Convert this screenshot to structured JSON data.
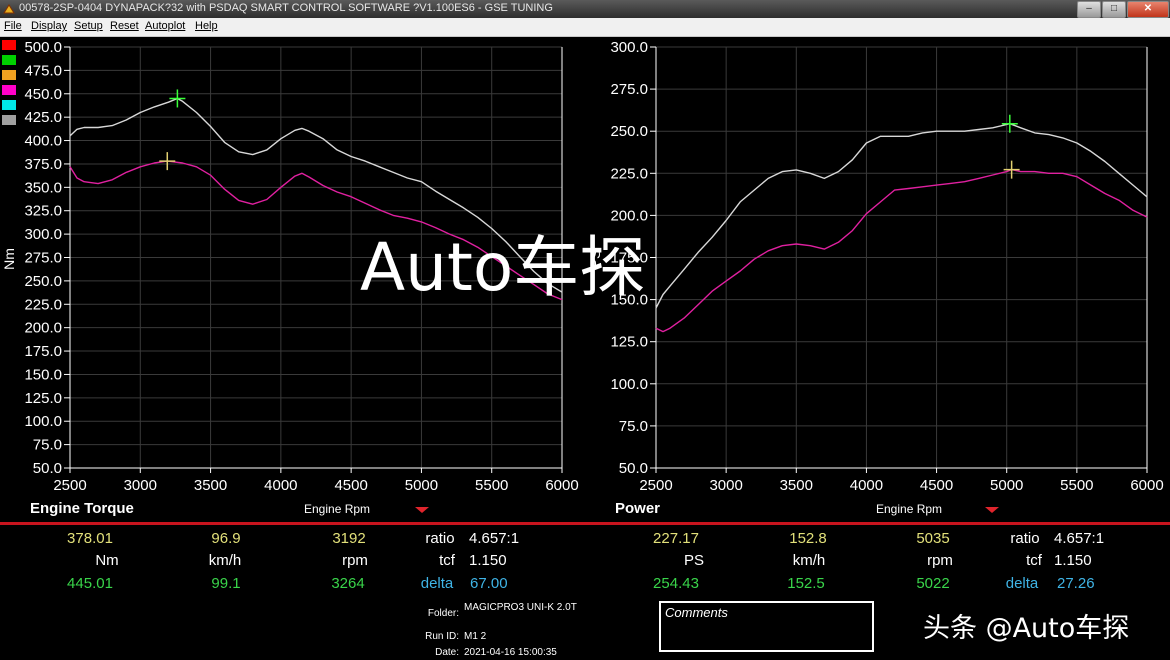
{
  "window": {
    "title": "00578-2SP-0404 DYNAPACK?32 with PSDAQ SMART CONTROL SOFTWARE ?V1.100ES6 - GSE TUNING",
    "buttons": [
      "–",
      "□",
      "✕"
    ]
  },
  "menu": [
    "File",
    "Display",
    "Setup",
    "Reset",
    "Autoplot",
    "Help"
  ],
  "legend_swatches": [
    "#ff0000",
    "#00d000",
    "#f0a020",
    "#ff00c8",
    "#00e8e8",
    "#a0a0a0"
  ],
  "watermark": "Auto车探",
  "logo_watermark": "头条 @Auto车探",
  "chart_data": [
    {
      "type": "line",
      "title": "Engine Torque",
      "xlabel": "Engine Rpm",
      "ylabel": "Nm",
      "xlim": [
        2500,
        6000
      ],
      "ylim": [
        50,
        500
      ],
      "xticks": [
        2500,
        3000,
        3500,
        4000,
        4500,
        5000,
        5500,
        6000
      ],
      "yticks": [
        50,
        75,
        100,
        125,
        150,
        175,
        200,
        225,
        250,
        275,
        300,
        325,
        350,
        375,
        400,
        425,
        450,
        475,
        500
      ],
      "grid": true,
      "series": [
        {
          "color": "#d8d8d8",
          "x": [
            2500,
            2550,
            2600,
            2700,
            2800,
            2900,
            3000,
            3100,
            3200,
            3264,
            3300,
            3400,
            3500,
            3600,
            3700,
            3800,
            3900,
            4000,
            4100,
            4150,
            4200,
            4300,
            4400,
            4500,
            4600,
            4700,
            4800,
            4900,
            5000,
            5100,
            5200,
            5300,
            5400,
            5500,
            5600,
            5700,
            5800,
            5900,
            6000
          ],
          "y": [
            405,
            412,
            414,
            414,
            416,
            422,
            430,
            436,
            441,
            445,
            442,
            430,
            415,
            398,
            388,
            385,
            390,
            402,
            411,
            413,
            410,
            402,
            390,
            383,
            378,
            372,
            366,
            360,
            356,
            346,
            337,
            328,
            318,
            306,
            292,
            276,
            260,
            247,
            238
          ]
        },
        {
          "color": "#e020a0",
          "x": [
            2500,
            2550,
            2600,
            2700,
            2800,
            2900,
            3000,
            3100,
            3192,
            3300,
            3400,
            3500,
            3600,
            3700,
            3800,
            3900,
            4000,
            4100,
            4150,
            4200,
            4300,
            4400,
            4500,
            4600,
            4700,
            4800,
            4900,
            5000,
            5100,
            5200,
            5300,
            5400,
            5500,
            5600,
            5700,
            5800,
            5900,
            6000
          ],
          "y": [
            372,
            360,
            356,
            354,
            358,
            366,
            372,
            376,
            378,
            376,
            372,
            363,
            348,
            336,
            332,
            337,
            350,
            362,
            365,
            361,
            352,
            345,
            340,
            333,
            326,
            320,
            317,
            313,
            307,
            300,
            294,
            286,
            276,
            266,
            256,
            246,
            236,
            230
          ]
        }
      ],
      "markers": [
        {
          "x": 3264,
          "y": 445.01,
          "color": "#39ff39"
        },
        {
          "x": 3192,
          "y": 378.01,
          "color": "#e2d070"
        }
      ]
    },
    {
      "type": "line",
      "title": "Power",
      "xlabel": "Engine Rpm",
      "ylabel": "PS",
      "xlim": [
        2500,
        6000
      ],
      "ylim": [
        50,
        300
      ],
      "xticks": [
        2500,
        3000,
        3500,
        4000,
        4500,
        5000,
        5500,
        6000
      ],
      "yticks": [
        50,
        75,
        100,
        125,
        150,
        175,
        200,
        225,
        250,
        275,
        300
      ],
      "grid": true,
      "series": [
        {
          "color": "#d8d8d8",
          "x": [
            2500,
            2550,
            2600,
            2700,
            2800,
            2900,
            3000,
            3100,
            3200,
            3300,
            3400,
            3500,
            3600,
            3700,
            3800,
            3900,
            4000,
            4100,
            4200,
            4300,
            4400,
            4500,
            4600,
            4700,
            4800,
            4900,
            5000,
            5022,
            5100,
            5200,
            5300,
            5400,
            5500,
            5600,
            5700,
            5800,
            5900,
            6000
          ],
          "y": [
            145,
            153,
            158,
            168,
            178,
            187,
            197,
            208,
            215,
            222,
            226,
            227,
            225,
            222,
            226,
            233,
            243,
            247,
            247,
            247,
            249,
            250,
            250,
            250,
            251,
            252,
            254,
            254.43,
            252,
            249,
            248,
            246,
            243,
            238,
            232,
            225,
            218,
            211
          ]
        },
        {
          "color": "#e020a0",
          "x": [
            2500,
            2550,
            2600,
            2700,
            2800,
            2900,
            3000,
            3100,
            3200,
            3300,
            3400,
            3500,
            3600,
            3700,
            3800,
            3900,
            4000,
            4100,
            4200,
            4300,
            4400,
            4500,
            4600,
            4700,
            4800,
            4900,
            5000,
            5035,
            5100,
            5200,
            5300,
            5400,
            5500,
            5600,
            5700,
            5800,
            5900,
            6000
          ],
          "y": [
            133,
            131,
            133,
            139,
            147,
            155,
            161,
            167,
            174,
            179,
            182,
            183,
            182,
            180,
            184,
            191,
            201,
            208,
            215,
            216,
            217,
            218,
            219,
            220,
            222,
            224,
            226,
            227.17,
            226,
            226,
            225,
            225,
            223,
            218,
            213,
            209,
            203,
            199
          ]
        }
      ],
      "markers": [
        {
          "x": 5022,
          "y": 254.43,
          "color": "#39ff39"
        },
        {
          "x": 5035,
          "y": 227.17,
          "color": "#e2d070"
        }
      ]
    }
  ],
  "torque_readout": {
    "val1": "378.01",
    "unit1": "Nm",
    "speed1": "96.9",
    "speed_unit": "km/h",
    "rpm1": "3192",
    "rpm_unit": "rpm",
    "ratio_label": "ratio",
    "ratio_value": "4.657:1",
    "tcf_label": "tcf",
    "tcf_value": "1.150",
    "val2": "445.01",
    "speed2": "99.1",
    "rpm2": "3264",
    "delta_label": "delta",
    "delta_value": "67.00"
  },
  "power_readout": {
    "val1": "227.17",
    "unit1": "PS",
    "speed1": "152.8",
    "speed_unit": "km/h",
    "rpm1": "5035",
    "rpm_unit": "rpm",
    "ratio_label": "ratio",
    "ratio_value": "4.657:1",
    "tcf_label": "tcf",
    "tcf_value": "1.150",
    "val2": "254.43",
    "speed2": "152.5",
    "rpm2": "5022",
    "delta_label": "delta",
    "delta_value": "27.26"
  },
  "run_info": {
    "folder_label": "Folder:",
    "folder_value": "MAGICPRO3 UNI-K 2.0T",
    "runid_label": "Run ID:",
    "runid_value": "M1 2",
    "date_label": "Date:",
    "date_value": "2021-04-16 15:00:35"
  },
  "comments_label": "Comments"
}
